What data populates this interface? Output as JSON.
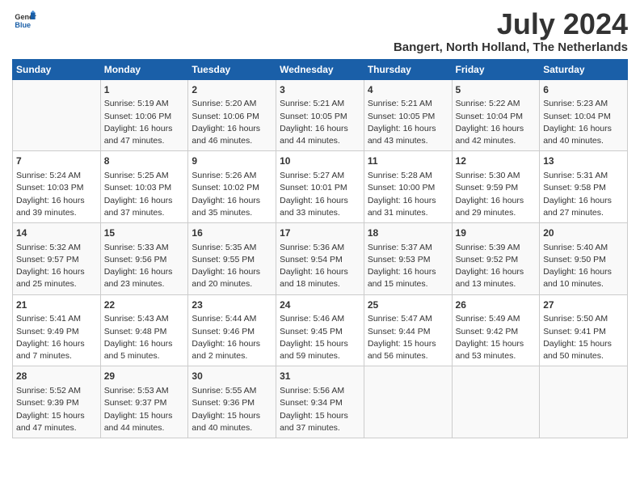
{
  "logo": {
    "line1": "General",
    "line2": "Blue"
  },
  "title": "July 2024",
  "subtitle": "Bangert, North Holland, The Netherlands",
  "columns": [
    "Sunday",
    "Monday",
    "Tuesday",
    "Wednesday",
    "Thursday",
    "Friday",
    "Saturday"
  ],
  "weeks": [
    [
      {
        "day": "",
        "content": ""
      },
      {
        "day": "1",
        "content": "Sunrise: 5:19 AM\nSunset: 10:06 PM\nDaylight: 16 hours\nand 47 minutes."
      },
      {
        "day": "2",
        "content": "Sunrise: 5:20 AM\nSunset: 10:06 PM\nDaylight: 16 hours\nand 46 minutes."
      },
      {
        "day": "3",
        "content": "Sunrise: 5:21 AM\nSunset: 10:05 PM\nDaylight: 16 hours\nand 44 minutes."
      },
      {
        "day": "4",
        "content": "Sunrise: 5:21 AM\nSunset: 10:05 PM\nDaylight: 16 hours\nand 43 minutes."
      },
      {
        "day": "5",
        "content": "Sunrise: 5:22 AM\nSunset: 10:04 PM\nDaylight: 16 hours\nand 42 minutes."
      },
      {
        "day": "6",
        "content": "Sunrise: 5:23 AM\nSunset: 10:04 PM\nDaylight: 16 hours\nand 40 minutes."
      }
    ],
    [
      {
        "day": "7",
        "content": "Sunrise: 5:24 AM\nSunset: 10:03 PM\nDaylight: 16 hours\nand 39 minutes."
      },
      {
        "day": "8",
        "content": "Sunrise: 5:25 AM\nSunset: 10:03 PM\nDaylight: 16 hours\nand 37 minutes."
      },
      {
        "day": "9",
        "content": "Sunrise: 5:26 AM\nSunset: 10:02 PM\nDaylight: 16 hours\nand 35 minutes."
      },
      {
        "day": "10",
        "content": "Sunrise: 5:27 AM\nSunset: 10:01 PM\nDaylight: 16 hours\nand 33 minutes."
      },
      {
        "day": "11",
        "content": "Sunrise: 5:28 AM\nSunset: 10:00 PM\nDaylight: 16 hours\nand 31 minutes."
      },
      {
        "day": "12",
        "content": "Sunrise: 5:30 AM\nSunset: 9:59 PM\nDaylight: 16 hours\nand 29 minutes."
      },
      {
        "day": "13",
        "content": "Sunrise: 5:31 AM\nSunset: 9:58 PM\nDaylight: 16 hours\nand 27 minutes."
      }
    ],
    [
      {
        "day": "14",
        "content": "Sunrise: 5:32 AM\nSunset: 9:57 PM\nDaylight: 16 hours\nand 25 minutes."
      },
      {
        "day": "15",
        "content": "Sunrise: 5:33 AM\nSunset: 9:56 PM\nDaylight: 16 hours\nand 23 minutes."
      },
      {
        "day": "16",
        "content": "Sunrise: 5:35 AM\nSunset: 9:55 PM\nDaylight: 16 hours\nand 20 minutes."
      },
      {
        "day": "17",
        "content": "Sunrise: 5:36 AM\nSunset: 9:54 PM\nDaylight: 16 hours\nand 18 minutes."
      },
      {
        "day": "18",
        "content": "Sunrise: 5:37 AM\nSunset: 9:53 PM\nDaylight: 16 hours\nand 15 minutes."
      },
      {
        "day": "19",
        "content": "Sunrise: 5:39 AM\nSunset: 9:52 PM\nDaylight: 16 hours\nand 13 minutes."
      },
      {
        "day": "20",
        "content": "Sunrise: 5:40 AM\nSunset: 9:50 PM\nDaylight: 16 hours\nand 10 minutes."
      }
    ],
    [
      {
        "day": "21",
        "content": "Sunrise: 5:41 AM\nSunset: 9:49 PM\nDaylight: 16 hours\nand 7 minutes."
      },
      {
        "day": "22",
        "content": "Sunrise: 5:43 AM\nSunset: 9:48 PM\nDaylight: 16 hours\nand 5 minutes."
      },
      {
        "day": "23",
        "content": "Sunrise: 5:44 AM\nSunset: 9:46 PM\nDaylight: 16 hours\nand 2 minutes."
      },
      {
        "day": "24",
        "content": "Sunrise: 5:46 AM\nSunset: 9:45 PM\nDaylight: 15 hours\nand 59 minutes."
      },
      {
        "day": "25",
        "content": "Sunrise: 5:47 AM\nSunset: 9:44 PM\nDaylight: 15 hours\nand 56 minutes."
      },
      {
        "day": "26",
        "content": "Sunrise: 5:49 AM\nSunset: 9:42 PM\nDaylight: 15 hours\nand 53 minutes."
      },
      {
        "day": "27",
        "content": "Sunrise: 5:50 AM\nSunset: 9:41 PM\nDaylight: 15 hours\nand 50 minutes."
      }
    ],
    [
      {
        "day": "28",
        "content": "Sunrise: 5:52 AM\nSunset: 9:39 PM\nDaylight: 15 hours\nand 47 minutes."
      },
      {
        "day": "29",
        "content": "Sunrise: 5:53 AM\nSunset: 9:37 PM\nDaylight: 15 hours\nand 44 minutes."
      },
      {
        "day": "30",
        "content": "Sunrise: 5:55 AM\nSunset: 9:36 PM\nDaylight: 15 hours\nand 40 minutes."
      },
      {
        "day": "31",
        "content": "Sunrise: 5:56 AM\nSunset: 9:34 PM\nDaylight: 15 hours\nand 37 minutes."
      },
      {
        "day": "",
        "content": ""
      },
      {
        "day": "",
        "content": ""
      },
      {
        "day": "",
        "content": ""
      }
    ]
  ]
}
